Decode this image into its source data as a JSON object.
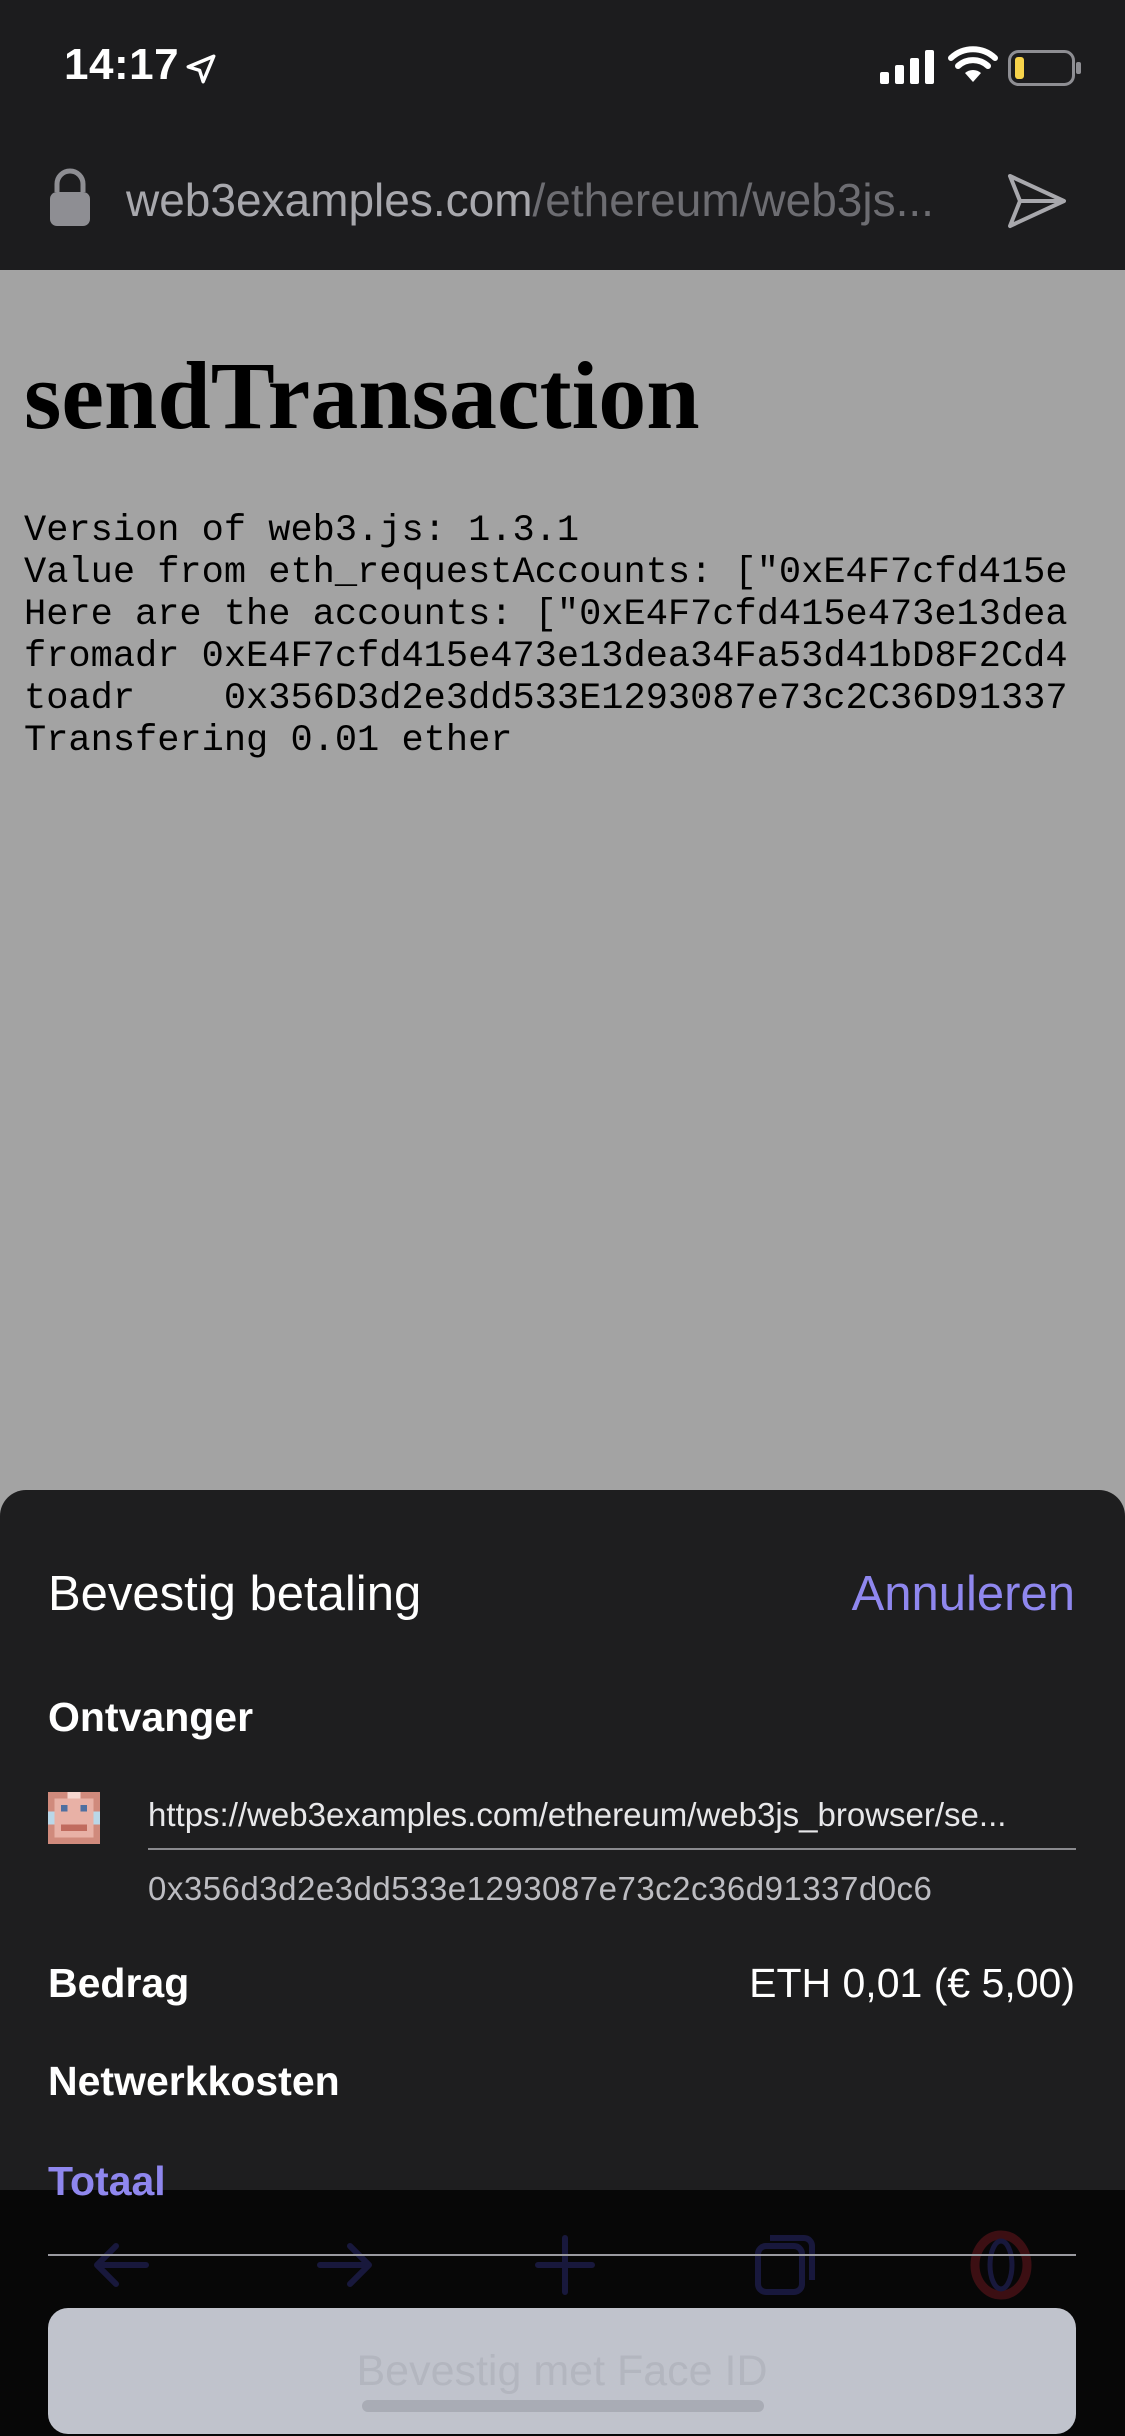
{
  "status_bar": {
    "time": "14:17",
    "icons": [
      "location-arrow-icon",
      "cellular-signal-icon",
      "wifi-icon",
      "battery-low-icon"
    ]
  },
  "url_bar": {
    "domain": "web3examples.com",
    "path": "/ethereum/web3js..."
  },
  "page": {
    "title": "sendTransaction",
    "console_lines": [
      "Version of web3.js: 1.3.1",
      "Value from eth_requestAccounts: [\"0xE4F7cfd415e",
      "Here are the accounts: [\"0xE4F7cfd415e473e13dea",
      "fromadr 0xE4F7cfd415e473e13dea34Fa53d41bD8F2Cd4",
      "toadr    0x356D3d2e3dd533E1293087e73c2C36D91337",
      "Transfering 0.01 ether"
    ]
  },
  "sheet": {
    "title": "Bevestig betaling",
    "cancel_label": "Annuleren",
    "recipient_label": "Ontvanger",
    "recipient_url": "https://web3examples.com/ethereum/web3js_browser/se...",
    "recipient_address": "0x356d3d2e3dd533e1293087e73c2c36d91337d0c6",
    "amount_label": "Bedrag",
    "amount_value": "ETH 0,01 (€ 5,00)",
    "fee_label": "Netwerkkosten",
    "total_label": "Totaal",
    "confirm_label": "Bevestig met Face ID"
  },
  "colors": {
    "accent": "#8f87ee",
    "sheet_background": "#1e1e1f",
    "page_overlay": "#a3a3a3",
    "battery_level": "#f7d34b"
  },
  "toolbar_icons": [
    "back-arrow-icon",
    "forward-arrow-icon",
    "new-tab-plus-icon",
    "tabs-icon",
    "opera-logo-icon"
  ]
}
